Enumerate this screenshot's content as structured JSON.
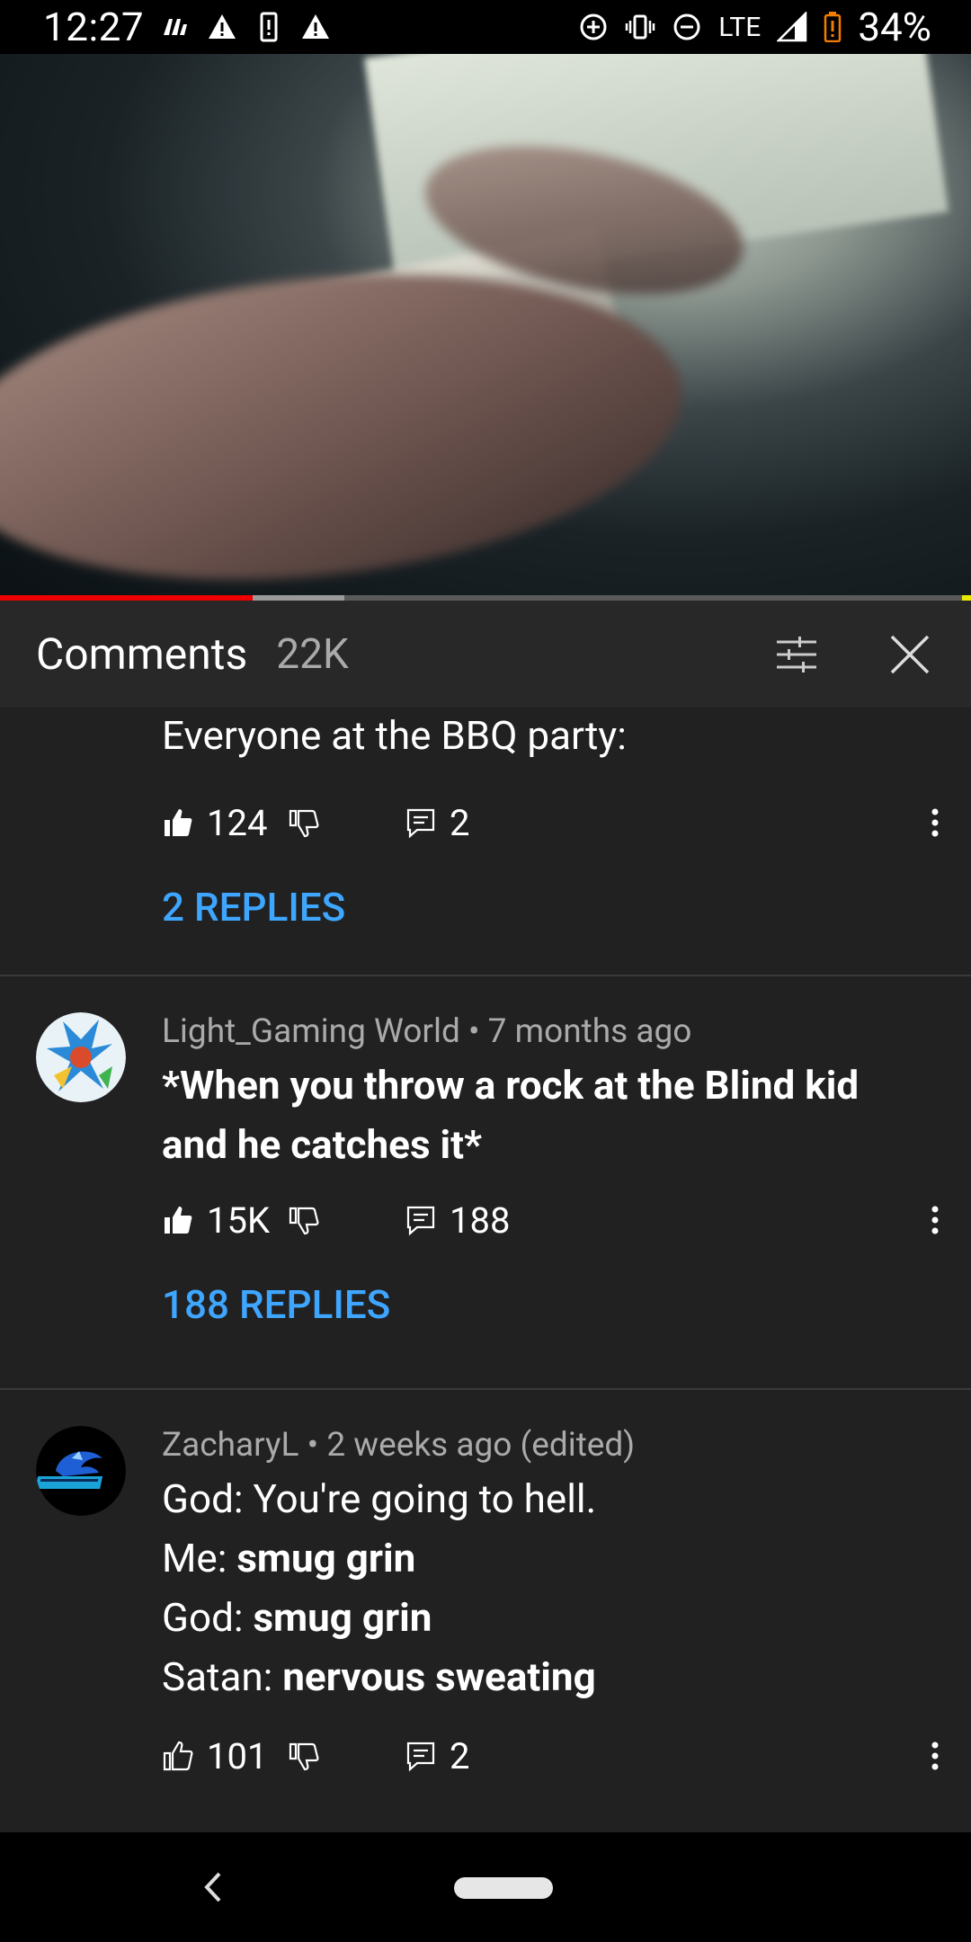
{
  "status_bar": {
    "time": "12:27",
    "network": "LTE",
    "battery_pct": "34%"
  },
  "video": {
    "progress_played_pct": 26,
    "progress_buffered_pct": 35.5
  },
  "comments_header": {
    "title": "Comments",
    "count": "22K",
    "icons": [
      "filter-sort-icon",
      "close-icon"
    ]
  },
  "comments": [
    {
      "text_line": "Everyone at the BBQ party:",
      "likes": "124",
      "replies_count": "2",
      "replies_link": "2 REPLIES"
    },
    {
      "author": "Light_Gaming World",
      "time": "7 months ago",
      "text": "*When you throw a rock at the Blind kid and he catches it*",
      "likes": "15K",
      "replies_count": "188",
      "replies_link": "188 REPLIES"
    },
    {
      "author": "ZacharyL",
      "time": "2 weeks ago (edited)",
      "lines": [
        {
          "prefix": "God: ",
          "bold": "",
          "plain": "You're going to hell."
        },
        {
          "prefix": "Me: ",
          "bold": "smug grin",
          "plain": ""
        },
        {
          "prefix": "God: ",
          "bold": "smug grin",
          "plain": ""
        },
        {
          "prefix": "Satan: ",
          "bold": "nervous sweating",
          "plain": ""
        }
      ],
      "likes": "101",
      "replies_count": "2"
    }
  ],
  "colors": {
    "background": "#212121",
    "header_bg": "#282828",
    "link_blue": "#3ea6ff",
    "progress_red": "#ee0000"
  }
}
